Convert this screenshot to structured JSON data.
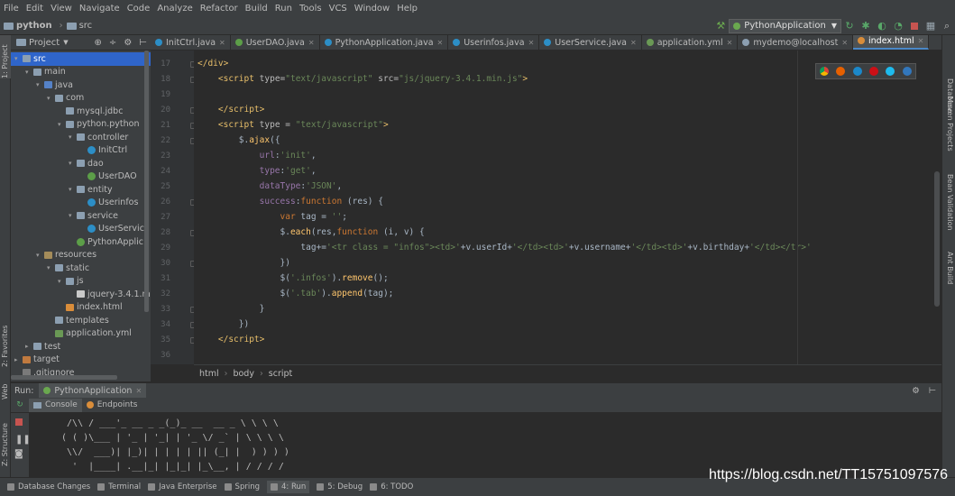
{
  "menu": [
    "File",
    "Edit",
    "View",
    "Navigate",
    "Code",
    "Analyze",
    "Refactor",
    "Build",
    "Run",
    "Tools",
    "VCS",
    "Window",
    "Help"
  ],
  "nav": {
    "project": "python",
    "folder": "src",
    "run_config": "PythonApplication"
  },
  "left_stripe": {
    "project": "1: Project",
    "favorites": "2: Favorites",
    "web": "Web",
    "structure": "Z: Structure"
  },
  "right_stripe": {
    "database": "Database",
    "maven": "Maven Projects",
    "bean": "Bean Validation",
    "ant": "Ant Build"
  },
  "project_panel": {
    "title": "Project",
    "tree": [
      {
        "label": "src",
        "depth": 0,
        "icon": "f",
        "arrow": "▾",
        "selected": true
      },
      {
        "label": "main",
        "depth": 1,
        "icon": "f",
        "arrow": "▾"
      },
      {
        "label": "java",
        "depth": 2,
        "icon": "src",
        "arrow": "▾"
      },
      {
        "label": "com",
        "depth": 3,
        "icon": "f",
        "arrow": "▾"
      },
      {
        "label": "mysql.jdbc",
        "depth": 4,
        "icon": "f",
        "arrow": ""
      },
      {
        "label": "python.python",
        "depth": 4,
        "icon": "f",
        "arrow": "▾"
      },
      {
        "label": "controller",
        "depth": 5,
        "icon": "f",
        "arrow": "▾"
      },
      {
        "label": "InitCtrl",
        "depth": 6,
        "icon": "c",
        "arrow": ""
      },
      {
        "label": "dao",
        "depth": 5,
        "icon": "f",
        "arrow": "▾"
      },
      {
        "label": "UserDAO",
        "depth": 6,
        "icon": "s",
        "arrow": ""
      },
      {
        "label": "entity",
        "depth": 5,
        "icon": "f",
        "arrow": "▾"
      },
      {
        "label": "Userinfos",
        "depth": 6,
        "icon": "c",
        "arrow": ""
      },
      {
        "label": "service",
        "depth": 5,
        "icon": "f",
        "arrow": "▾"
      },
      {
        "label": "UserServic",
        "depth": 6,
        "icon": "c",
        "arrow": ""
      },
      {
        "label": "PythonApplic",
        "depth": 5,
        "icon": "s",
        "arrow": ""
      },
      {
        "label": "resources",
        "depth": 2,
        "icon": "res",
        "arrow": "▾"
      },
      {
        "label": "static",
        "depth": 3,
        "icon": "f",
        "arrow": "▾"
      },
      {
        "label": "js",
        "depth": 4,
        "icon": "f",
        "arrow": "▾"
      },
      {
        "label": "jquery-3.4.1.m",
        "depth": 5,
        "icon": "j",
        "arrow": ""
      },
      {
        "label": "index.html",
        "depth": 4,
        "icon": "h",
        "arrow": ""
      },
      {
        "label": "templates",
        "depth": 3,
        "icon": "f",
        "arrow": ""
      },
      {
        "label": "application.yml",
        "depth": 3,
        "icon": "y",
        "arrow": ""
      },
      {
        "label": "test",
        "depth": 1,
        "icon": "f",
        "arrow": "▸"
      },
      {
        "label": "target",
        "depth": 0,
        "icon": "t",
        "arrow": "▸"
      },
      {
        "label": ".gitignore",
        "depth": 0,
        "icon": "x",
        "arrow": ""
      }
    ]
  },
  "tabs": [
    {
      "label": "InitCtrl.java",
      "color": "#2c8ec6",
      "active": false
    },
    {
      "label": "UserDAO.java",
      "color": "#5c9e48",
      "active": false
    },
    {
      "label": "PythonApplication.java",
      "color": "#2c8ec6",
      "active": false
    },
    {
      "label": "Userinfos.java",
      "color": "#2c8ec6",
      "active": false
    },
    {
      "label": "UserService.java",
      "color": "#2c8ec6",
      "active": false
    },
    {
      "label": "application.yml",
      "color": "#6a9955",
      "active": false
    },
    {
      "label": "mydemo@localhost",
      "color": "#8c9fb1",
      "active": false
    },
    {
      "label": "index.html",
      "color": "#d98d3a",
      "active": true
    }
  ],
  "code_lines": [
    {
      "n": "17",
      "html": "<span class=\"tag\">&lt;/div&gt;</span>"
    },
    {
      "n": "18",
      "html": "    <span class=\"tag\">&lt;script </span><span class=\"attr\">type=</span><span class=\"str\">\"text/javascript\"</span><span class=\"attr\"> src=</span><span class=\"str\">\"js/jquery-3.4.1.min.js\"</span><span class=\"tag\">&gt;</span>"
    },
    {
      "n": "19",
      "html": ""
    },
    {
      "n": "20",
      "html": "    <span class=\"tag\">&lt;/script&gt;</span>"
    },
    {
      "n": "21",
      "html": "    <span class=\"tag\">&lt;script </span><span class=\"attr\">type = </span><span class=\"str\">\"text/javascript\"</span><span class=\"tag\">&gt;</span>"
    },
    {
      "n": "22",
      "html": "        $.<span class=\"fn\">ajax</span>({"
    },
    {
      "n": "23",
      "html": "            <span class=\"hl\">url</span>:<span class=\"str\">'init'</span>,"
    },
    {
      "n": "24",
      "html": "            <span class=\"hl\">type</span>:<span class=\"str\">'get'</span>,"
    },
    {
      "n": "25",
      "html": "            <span class=\"hl\">dataType</span>:<span class=\"str\">'JSON'</span>,"
    },
    {
      "n": "26",
      "html": "            <span class=\"hl\">success</span>:<span class=\"kw\">function</span> (res) {"
    },
    {
      "n": "27",
      "html": "                <span class=\"kw\">var</span> tag = <span class=\"str\">''</span>;"
    },
    {
      "n": "28",
      "html": "                $.<span class=\"fn\">each</span>(res,<span class=\"kw\">function</span> (i, v) {"
    },
    {
      "n": "29",
      "html": "                    tag+=<span class=\"str\">'&lt;tr class = \"infos\"&gt;&lt;td&gt;'</span>+v.userId+<span class=\"str\">'&lt;/td&gt;&lt;td&gt;'</span>+v.username+<span class=\"str\">'&lt;/td&gt;&lt;td&gt;'</span>+v.birthday+<span class=\"str\">'&lt;/td&gt;&lt;/tr&gt;'</span>"
    },
    {
      "n": "30",
      "html": "                })"
    },
    {
      "n": "31",
      "html": "                $(<span class=\"str\">'.infos'</span>).<span class=\"fn\">remove</span>();"
    },
    {
      "n": "32",
      "html": "                $(<span class=\"str\">'.tab'</span>).<span class=\"fn\">append</span>(tag);"
    },
    {
      "n": "33",
      "html": "            }"
    },
    {
      "n": "34",
      "html": "        })"
    },
    {
      "n": "35",
      "html": "    <span class=\"tag\">&lt;/script&gt;</span>"
    },
    {
      "n": "36",
      "html": ""
    }
  ],
  "breadcrumb": [
    "html",
    "body",
    "script"
  ],
  "run": {
    "label": "Run:",
    "config": "PythonApplication",
    "console_tab": "Console",
    "endpoints_tab": "Endpoints"
  },
  "console_lines": [
    "  /\\\\ / ___'_ __ _ _(_)_ __  __ _ \\ \\ \\ \\",
    " ( ( )\\___ | '_ | '_| | '_ \\/ _` | \\ \\ \\ \\",
    "  \\\\/  ___)| |_)| | | | | || (_| |  ) ) ) )",
    "   '  |____| .__|_| |_|_| |_\\__, | / / / /"
  ],
  "bottom_tabs": [
    "Database Changes",
    "Terminal",
    "Java Enterprise",
    "Spring",
    "4: Run",
    "5: Debug",
    "6: TODO"
  ],
  "watermark": "https://blog.csdn.net/TT15751097576"
}
